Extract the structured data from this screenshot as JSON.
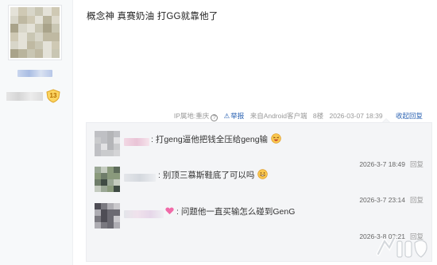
{
  "post": {
    "text": "概念神 真赛奶油 打GG就靠他了",
    "level_badge": "13"
  },
  "meta": {
    "ip": "IP属地:重庆",
    "help_icon": "?",
    "report": "举报",
    "client": "来自Android客户端",
    "floor": "8楼",
    "datetime": "2026-03-07 18:39",
    "collapse": "收起回复"
  },
  "replies": [
    {
      "separator": ":",
      "text": "打geng逼他把钱全压给geng输",
      "emoji": "laughing-face-icon",
      "time": "2026-3-7 18:49",
      "reply_label": "回复"
    },
    {
      "separator": ":",
      "text": "别顶三慕斯鞋底了可以吗",
      "emoji": "grinning-face-icon",
      "time": "2026-3-7 23:14",
      "reply_label": "回复"
    },
    {
      "separator": ":",
      "text": "问题他一直买输怎么碰到GenG",
      "emoji": "heart-icon",
      "time": "2026-3-8 03:21",
      "reply_label": "回复"
    }
  ],
  "colors": {
    "link_blue": "#2d64b3",
    "reply_bg": "#f4f5f7",
    "badge_gold": "#f5c842"
  }
}
